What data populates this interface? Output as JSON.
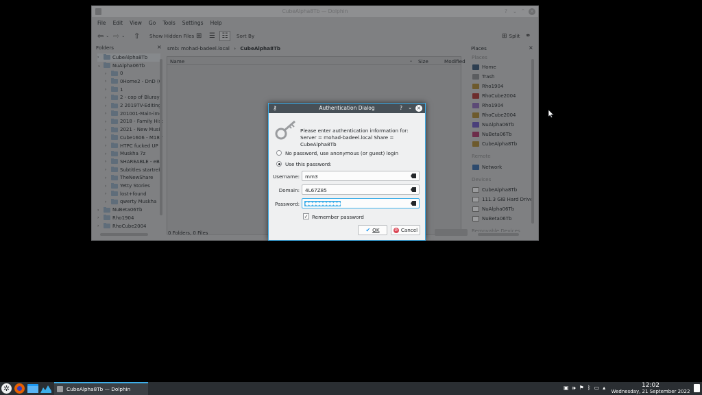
{
  "window": {
    "title": "CubeAlpha8Tb — Dolphin"
  },
  "menu": [
    "File",
    "Edit",
    "View",
    "Go",
    "Tools",
    "Settings",
    "Help"
  ],
  "toolbar": {
    "show_hidden": "Show Hidden Files",
    "sort_by": "Sort By",
    "split": "Split"
  },
  "folders": {
    "header": "Folders",
    "items": [
      "CubeAlpha8Tb",
      "NuAlpha06Tb",
      "0",
      "0Home2 - DnD (O",
      "1",
      "2 - cop of Bluray f",
      "2 2019TV-Editing",
      "201001-Main-img",
      "2018 - Family Hist",
      "2021 - New Music",
      "Cube1606 - M18 r",
      "HTPC fucked UP",
      "Muskha 7z",
      "SHAREABLE - eBo",
      "Subtitles startrek",
      "TheNewShare",
      "Yetty Stories",
      "lost+found",
      "qwerty Muskha",
      "NuBeta06Tb",
      "Rho1904",
      "RhoCube2004"
    ]
  },
  "breadcrumb": {
    "parent": "smb: mohad-badeel.local",
    "current": "CubeAlpha8Tb"
  },
  "columns": {
    "name": "Name",
    "size": "Size",
    "modified": "Modified"
  },
  "status": "0 Folders, 0 Files",
  "places": {
    "header": "Places",
    "section_places": "Places",
    "items": [
      "Home",
      "Trash",
      "Rho1904",
      "RhoCube2004",
      "Rho1904",
      "RhoCube2004",
      "NuAlpha06Tb",
      "NuBeta06Tb",
      "CubeAlpha8Tb"
    ],
    "section_remote": "Remote",
    "remote_items": [
      "Network"
    ],
    "section_devices": "Devices",
    "device_items": [
      "CubeAlpha8Tb",
      "111.3 GiB Hard Drive",
      "NuAlpha06Tb",
      "NuBeta06Tb"
    ],
    "section_removable": "Removable Devices"
  },
  "dialog": {
    "title": "Authentication Dialog",
    "message": "Please enter authentication information for: Server = mohad-badeel.local Share = CubeAlpha8Tb",
    "anon_option": "No password, use anonymous (or guest) login",
    "use_password_option": "Use this password:",
    "username_label": "Username:",
    "username_value": "mm3",
    "domain_label": "Domain:",
    "domain_value": "4L67Z85",
    "password_label": "Password:",
    "password_masked": "●●●●●●●●●●",
    "remember_label": "Remember password",
    "ok_label": "OK",
    "cancel_label": "Cancel"
  },
  "taskbar": {
    "task_title": "CubeAlpha8Tb — Dolphin",
    "time": "12:02",
    "date": "Wednesday, 21 September 2022"
  }
}
